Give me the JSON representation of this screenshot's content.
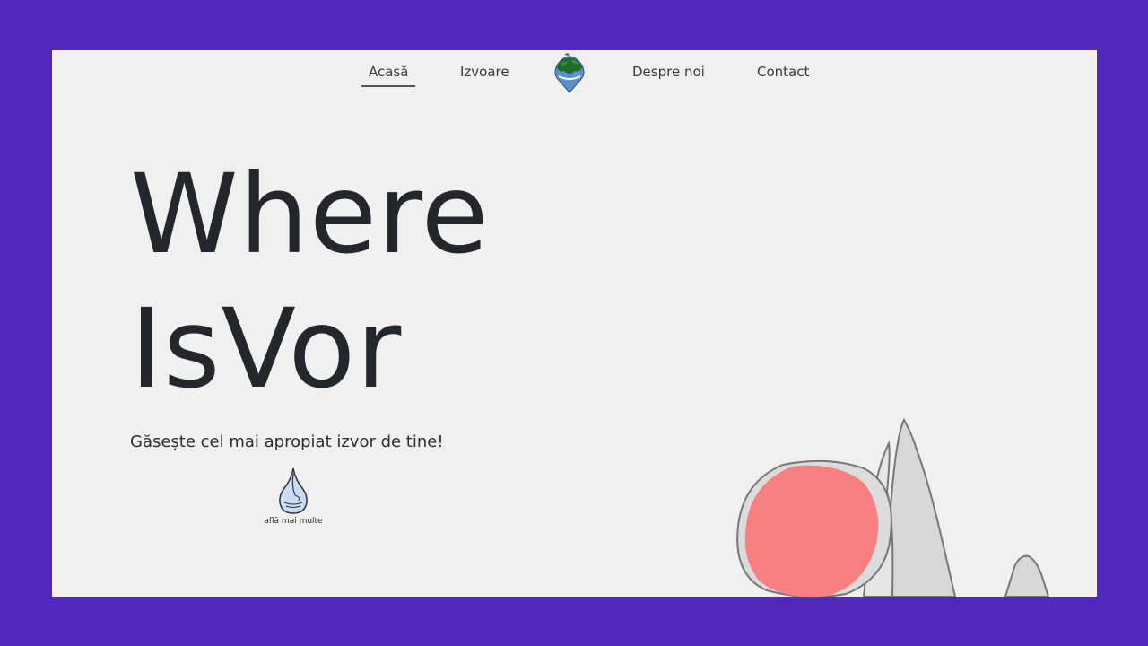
{
  "nav": {
    "items": [
      {
        "label": "Acasă",
        "active": true
      },
      {
        "label": "Izvoare",
        "active": false
      },
      {
        "label": "Despre noi",
        "active": false
      },
      {
        "label": "Contact",
        "active": false
      }
    ],
    "logo_icon": "water-drop-forest-logo-icon"
  },
  "hero": {
    "title_line1": "Where",
    "title_line2": "IsVor",
    "subtitle": "Găsește cel mai apropiat izvor de tine!"
  },
  "cta": {
    "label": "află mai multe",
    "icon": "water-drop-icon"
  },
  "illustration": {
    "sun_color": "#f98080",
    "mountain_color": "#d8d8d8"
  },
  "colors": {
    "frame_border": "#5227bb",
    "background": "#f0f0f0",
    "text": "#23272b"
  }
}
